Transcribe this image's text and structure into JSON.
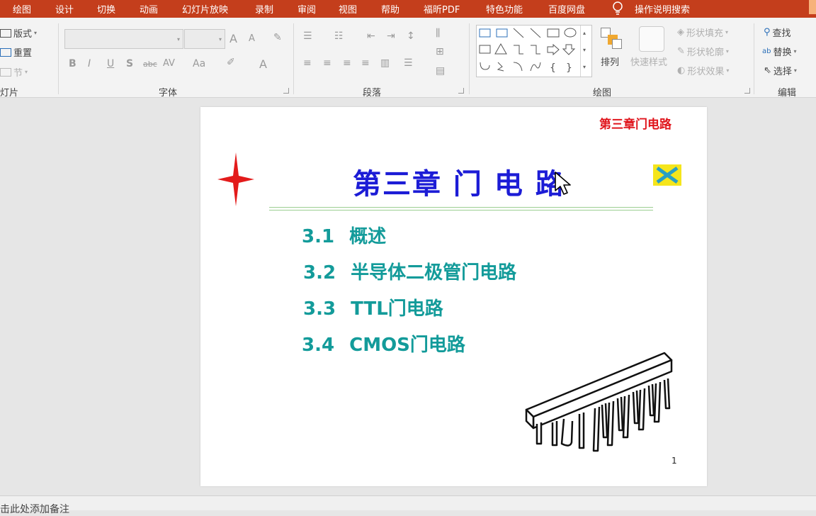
{
  "menu": {
    "tabs": [
      "绘图",
      "设计",
      "切换",
      "动画",
      "幻灯片放映",
      "录制",
      "审阅",
      "视图",
      "帮助",
      "福昕PDF",
      "特色功能",
      "百度网盘"
    ],
    "search": "操作说明搜索"
  },
  "ribbon": {
    "slides": {
      "layout": "版式",
      "reset": "重置",
      "section": "节",
      "label": "灯片"
    },
    "font": {
      "bold": "B",
      "italic": "I",
      "underline": "U",
      "shadow": "S",
      "strike": "abc",
      "spacing": "AV",
      "case": "Aa",
      "grow": "A",
      "shrink": "A",
      "color": "A",
      "label": "字体"
    },
    "paragraph": {
      "label": "段落"
    },
    "drawing": {
      "arrange": "排列",
      "quick_styles": "快速样式",
      "fill": "形状填充",
      "outline": "形状轮廓",
      "effects": "形状效果",
      "label": "绘图"
    },
    "editing": {
      "find": "查找",
      "replace": "替换",
      "select": "选择",
      "label": "编辑"
    }
  },
  "slide": {
    "header_label": "第三章门电路",
    "title": "第三章 门 电 路",
    "items": [
      {
        "num": "3.1",
        "text": "概述"
      },
      {
        "num": "3.2",
        "text": "半导体二极管门电路"
      },
      {
        "num": "3.3",
        "text": "TTL门电路"
      },
      {
        "num": "3.4",
        "text": "CMOS门电路"
      }
    ],
    "page_number": "1"
  },
  "status": {
    "notes": "击此处添加备注"
  },
  "colors": {
    "menu_bg": "#c43e1c",
    "title": "#1c1cd6",
    "toc": "#139b9a",
    "header_label": "#e0151c",
    "star": "#e31b1b"
  }
}
